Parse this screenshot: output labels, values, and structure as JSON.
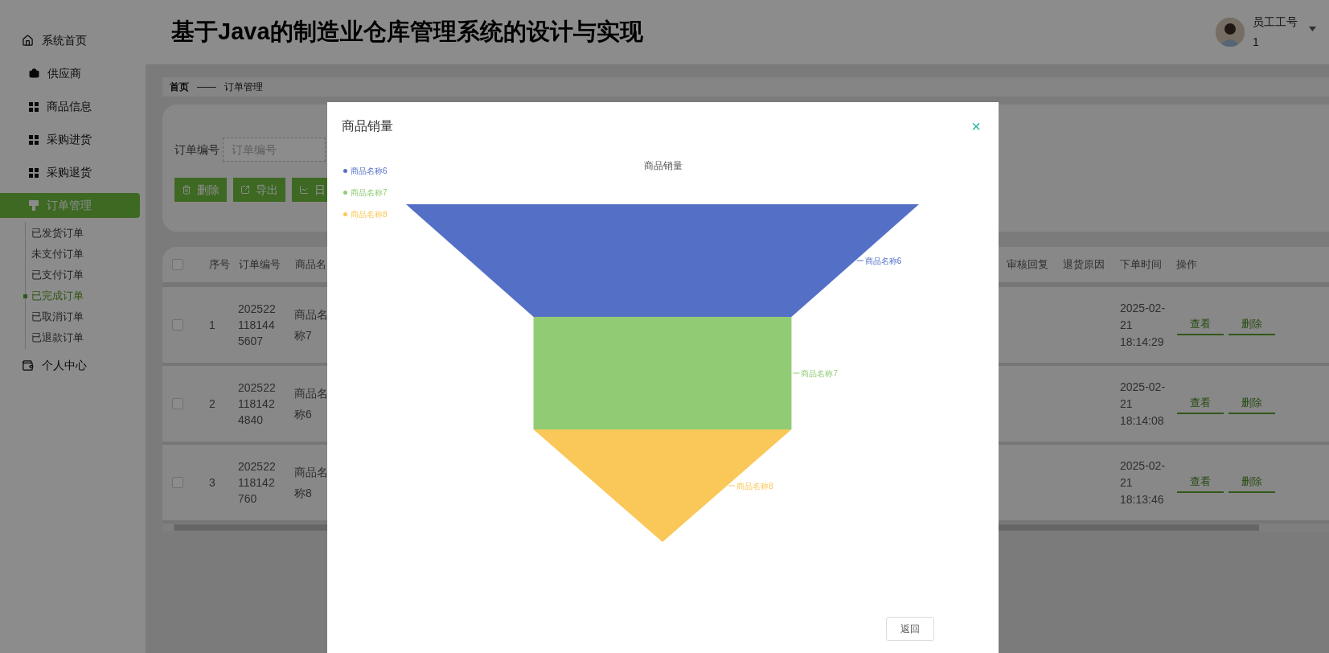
{
  "header": {
    "title": "基于Java的制造业仓库管理系统的设计与实现",
    "user_label": "员工工号",
    "user_value": "1"
  },
  "sidebar": {
    "items": [
      {
        "label": "系统首页",
        "selected": false
      },
      {
        "label": "供应商",
        "selected": false
      },
      {
        "label": "商品信息",
        "selected": false
      },
      {
        "label": "采购进货",
        "selected": false
      },
      {
        "label": "采购退货",
        "selected": false
      },
      {
        "label": "订单管理",
        "selected": true,
        "children": [
          {
            "label": "已发货订单",
            "selected": false
          },
          {
            "label": "未支付订单",
            "selected": false
          },
          {
            "label": "已支付订单",
            "selected": false
          },
          {
            "label": "已完成订单",
            "selected": true
          },
          {
            "label": "已取消订单",
            "selected": false
          },
          {
            "label": "已退款订单",
            "selected": false
          }
        ]
      },
      {
        "label": "个人中心",
        "selected": false
      }
    ]
  },
  "breadcrumb": {
    "items": [
      "首页",
      "订单管理"
    ],
    "separator": "——"
  },
  "search": {
    "label": "订单编号",
    "placeholder": "订单编号"
  },
  "toolbar": [
    "删除",
    "导出",
    "日"
  ],
  "table": {
    "select_all_checked": false,
    "columns_left": [
      "序号",
      "订单编号",
      "商品名"
    ],
    "columns_right": [
      "审核回复",
      "退货原因",
      "下单时间",
      "操作"
    ],
    "rows": [
      {
        "checked": false,
        "index": "1",
        "order_no": "2025221181445607",
        "product": "商品名称7",
        "time": "2025-02-21 18:14:29",
        "actions": [
          "查看",
          "删除"
        ]
      },
      {
        "checked": false,
        "index": "2",
        "order_no": "2025221181424840",
        "product": "商品名称6",
        "time": "2025-02-21 18:14:08",
        "actions": [
          "查看",
          "删除"
        ]
      },
      {
        "checked": false,
        "index": "3",
        "order_no": "202522118142760",
        "product": "商品名称8",
        "time": "2025-02-21 18:13:46",
        "actions": [
          "查看",
          "删除"
        ]
      }
    ]
  },
  "dialog": {
    "title": "商品销量",
    "close": "×",
    "chart_title": "商品销量",
    "legend": [
      {
        "label": "商品名称6",
        "color": "#5470c6"
      },
      {
        "label": "商品名称7",
        "color": "#91cc75"
      },
      {
        "label": "商品名称8",
        "color": "#fac858"
      }
    ],
    "segments": [
      {
        "label": "商品名称6",
        "color": "#5470c6"
      },
      {
        "label": "商品名称7",
        "color": "#91cc75"
      },
      {
        "label": "商品名称8",
        "color": "#fac858"
      }
    ],
    "footer_button": "返回"
  }
}
